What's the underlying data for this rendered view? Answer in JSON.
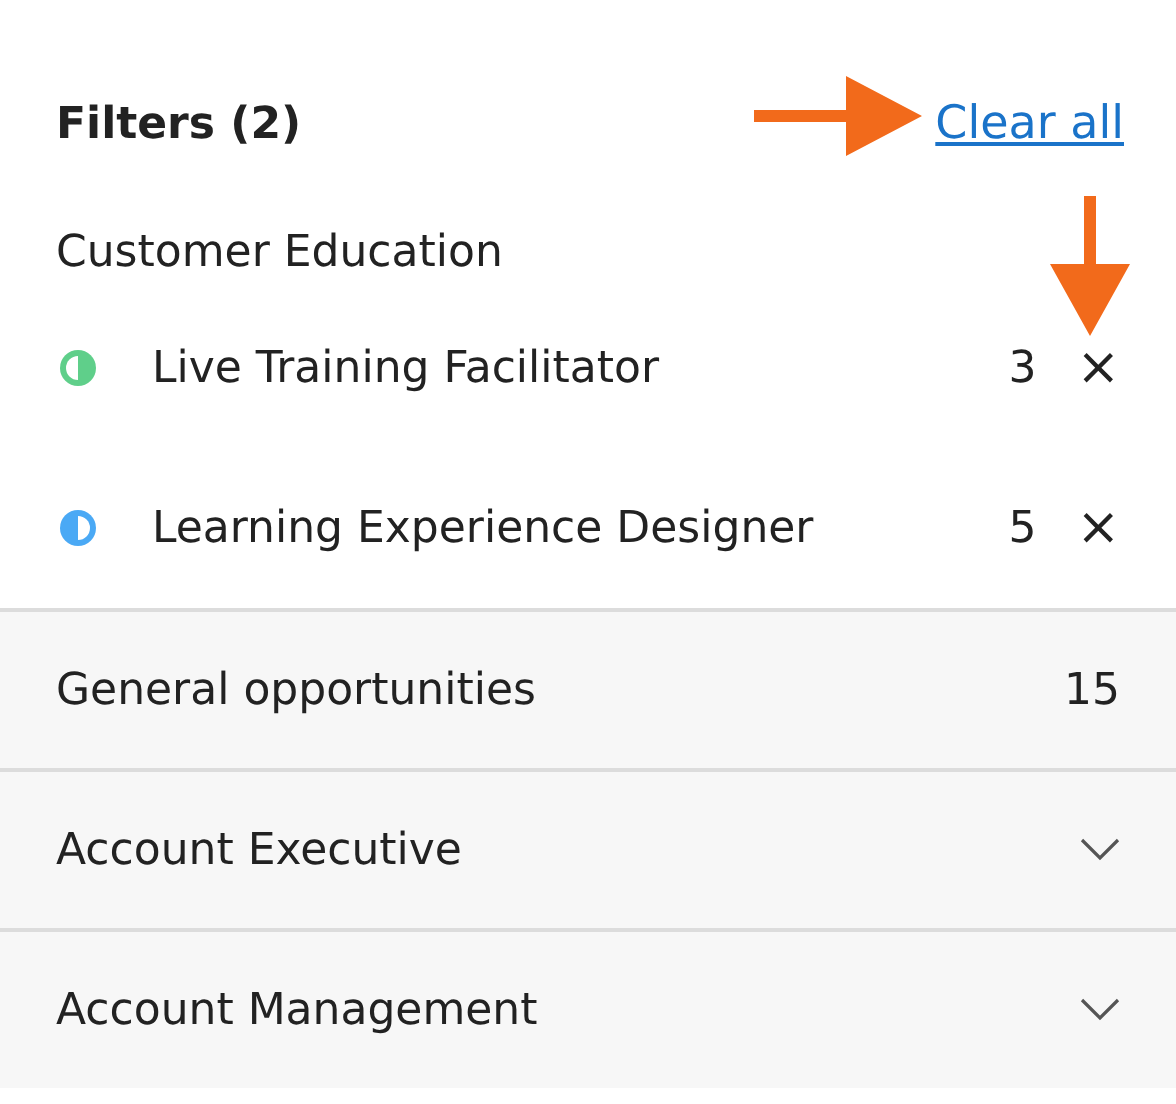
{
  "header": {
    "title": "Filters (2)",
    "clear_link": "Clear all"
  },
  "group": {
    "title": "Customer Education",
    "items": [
      {
        "label": "Live Training Facilitator",
        "count": "3",
        "color": "#5fcf8a",
        "kind": "left",
        "remove": "×"
      },
      {
        "label": "Learning Experience Designer",
        "count": "5",
        "color": "#4aa9f5",
        "kind": "right",
        "remove": "×"
      }
    ]
  },
  "sections": [
    {
      "label": "General opportunities",
      "kind": "count",
      "count": "15"
    },
    {
      "label": "Account Executive",
      "kind": "collapsed"
    },
    {
      "label": "Account Management",
      "kind": "collapsed"
    }
  ],
  "annotations": [
    {
      "kind": "rightarrow"
    },
    {
      "kind": "downarrow"
    }
  ]
}
